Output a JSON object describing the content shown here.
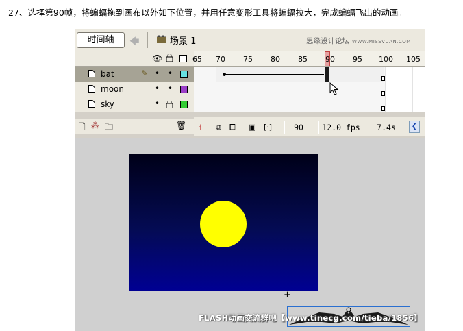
{
  "instruction": "27、选择第90帧，将蝙蝠拖到画布以外如下位置，并用任意变形工具将蝙蝠拉大，完成蝙蝠飞出的动画。",
  "toolbar": {
    "timeline_label": "时间轴",
    "scene_label": "场景 1",
    "watermark": "思缘设计论坛",
    "watermark_url": "WWW.MISSVUAN.COM"
  },
  "ruler": {
    "ticks": [
      "65",
      "70",
      "75",
      "80",
      "85",
      "90",
      "95",
      "100",
      "105"
    ],
    "current_frame": 90
  },
  "layers": [
    {
      "name": "bat",
      "selected": true,
      "color": "#66e0e0"
    },
    {
      "name": "moon",
      "selected": false,
      "color": "#9b3fc8"
    },
    {
      "name": "sky",
      "selected": false,
      "locked": true,
      "color": "#33cc33"
    }
  ],
  "status": {
    "frame": "90",
    "fps": "12.0 fps",
    "time": "7.4s"
  },
  "stage": {
    "background_top": "#000018",
    "background_bottom": "#000093",
    "moon_color": "#ffff00"
  },
  "footer_watermark": "FLASH动画交流群吧【www.tinecg.com/tieba/1856】"
}
